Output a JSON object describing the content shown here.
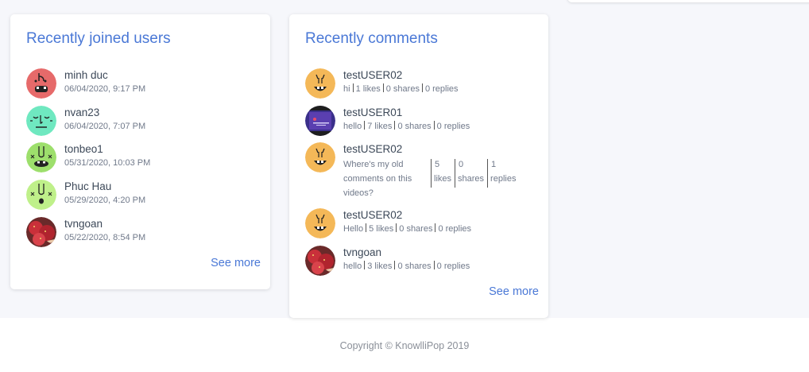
{
  "users_card": {
    "title": "Recently joined users",
    "see_more": "See more",
    "users": [
      {
        "name": "minh duc",
        "joined": "06/04/2020, 9:17 PM",
        "avatar": "red-face-avatar"
      },
      {
        "name": "nvan23",
        "joined": "06/04/2020, 7:07 PM",
        "avatar": "teal-face-avatar"
      },
      {
        "name": "tonbeo1",
        "joined": "05/31/2020, 10:03 PM",
        "avatar": "green-face-avatar"
      },
      {
        "name": "Phuc Hau",
        "joined": "05/29/2020, 4:20 PM",
        "avatar": "lime-face-avatar"
      },
      {
        "name": "tvngoan",
        "joined": "05/22/2020, 8:54 PM",
        "avatar": "strawberry-photo-avatar"
      }
    ]
  },
  "comments_card": {
    "title": "Recently comments",
    "see_more": "See more",
    "comments": [
      {
        "user": "testUSER02",
        "text": "hi",
        "likes": "1 likes",
        "shares": "0 shares",
        "replies": "0 replies"
      },
      {
        "user": "testUSER01",
        "text": "hello",
        "likes": "7 likes",
        "shares": "0 shares",
        "replies": "0 replies"
      },
      {
        "user": "testUSER02",
        "text": "Where's my old comments on this videos?",
        "likes_num": "5",
        "likes_word": "likes",
        "shares_num": "0",
        "shares_word": "shares",
        "replies_num": "1",
        "replies_word": "replies"
      },
      {
        "user": "testUSER02",
        "text": "Hello",
        "likes": "5 likes",
        "shares": "0 shares",
        "replies": "0 replies"
      },
      {
        "user": "tvngoan",
        "text": "hello",
        "likes": "3 likes",
        "shares": "0 shares",
        "replies": "0 replies"
      }
    ]
  },
  "footer": {
    "copyright": "Copyright © KnowlliPop 2019"
  },
  "colors": {
    "accent": "#4a78d6",
    "page_bg": "#f6f7fb"
  }
}
